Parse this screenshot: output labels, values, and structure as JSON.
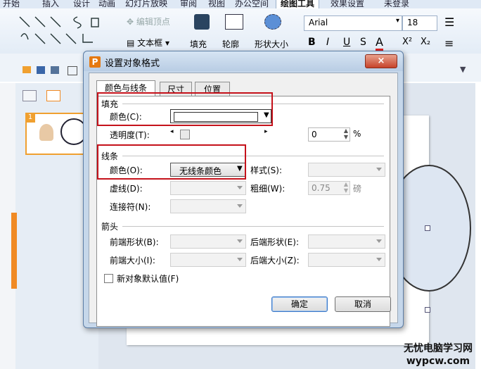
{
  "menubar": {
    "items": [
      "开始",
      "插入",
      "设计",
      "动画",
      "幻灯片放映",
      "审阅",
      "视图",
      "办公空间",
      "绘图工具",
      "效果设置",
      "未登录"
    ]
  },
  "ribbon": {
    "edit_points": "编辑顶点",
    "textbox": "文本框",
    "fill": "填充",
    "outline": "轮廓",
    "shape_size": "形状大小",
    "font_name": "Arial",
    "font_size": "18",
    "bold": "B",
    "italic": "I",
    "underline": "U",
    "strike": "S",
    "fontcolor": "A",
    "superscript": "X²",
    "subscript": "X₂"
  },
  "slides": {
    "thumb_number": "1"
  },
  "dialog": {
    "title": "设置对象格式",
    "close": "×",
    "tabs": [
      "颜色与线条",
      "尺寸",
      "位置"
    ],
    "fill": {
      "section": "填充",
      "color_label": "颜色(C):",
      "color_value": "",
      "transparency_label": "透明度(T):",
      "transparency_value": "0",
      "percent": "%"
    },
    "line": {
      "section": "线条",
      "color_label": "颜色(O):",
      "color_value": "无线条颜色",
      "style_label": "样式(S):",
      "dash_label": "虚线(D):",
      "weight_label": "粗细(W):",
      "weight_value": "0.75",
      "weight_unit": "磅",
      "connector_label": "连接符(N):"
    },
    "arrows": {
      "section": "箭头",
      "begin_style": "前端形状(B):",
      "end_style": "后端形状(E):",
      "begin_size": "前端大小(I):",
      "end_size": "后端大小(Z):"
    },
    "default_checkbox": "新对象默认值(F)",
    "ok": "确定",
    "cancel": "取消"
  },
  "watermark": {
    "line1": "无忧电脑学习网",
    "line2": "wypcw.com"
  }
}
